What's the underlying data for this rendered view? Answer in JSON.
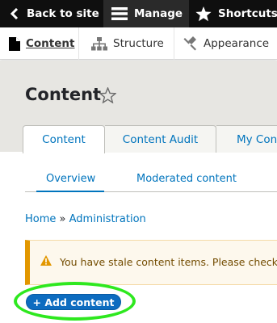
{
  "toolbar": {
    "back_label": "Back to site",
    "manage_label": "Manage",
    "shortcuts_label": "Shortcuts"
  },
  "tray": {
    "content_label": "Content",
    "structure_label": "Structure",
    "appearance_label": "Appearance"
  },
  "page": {
    "title": "Content"
  },
  "primary_tabs": [
    {
      "label": "Content",
      "active": true
    },
    {
      "label": "Content Audit",
      "active": false
    },
    {
      "label": "My Con",
      "active": false
    }
  ],
  "secondary_tabs": [
    {
      "label": "Overview",
      "active": true
    },
    {
      "label": "Moderated content",
      "active": false
    }
  ],
  "breadcrumb": {
    "home": "Home",
    "separator": "»",
    "admin": "Administration"
  },
  "message": {
    "type": "warning",
    "text": "You have stale content items. Please check"
  },
  "actions": {
    "add_content_label": "+ Add content"
  },
  "colors": {
    "toolbar_bg": "#0f0f0f",
    "link": "#0074bd",
    "button": "#0d6cc0",
    "warning_accent": "#e29700",
    "highlight": "#2ee81f"
  }
}
